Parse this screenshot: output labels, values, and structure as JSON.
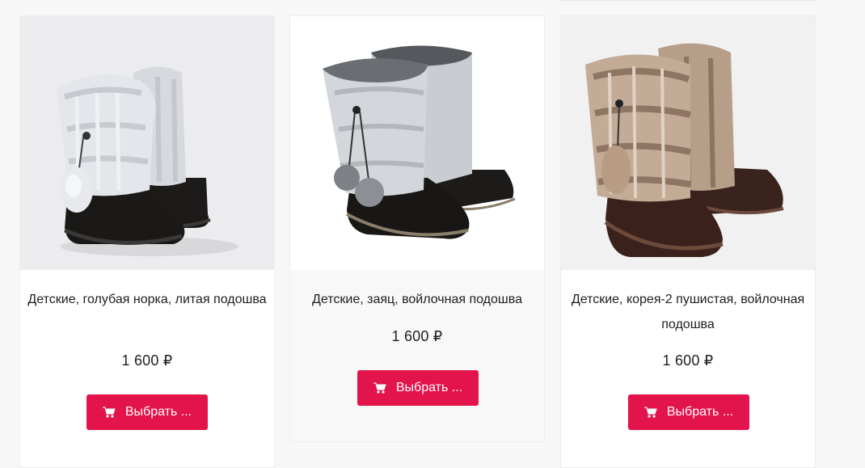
{
  "products": [
    {
      "title": "Детские, голубая норка, литая подошва",
      "price": "1 600 ₽",
      "button_label": "Выбрать ...",
      "icon": "cart-icon"
    },
    {
      "title": "Детские, заяц, войлочная подошва",
      "price": "1 600 ₽",
      "button_label": "Выбрать ...",
      "icon": "cart-icon"
    },
    {
      "title": "Детские, корея-2 пушистая, войлочная подошва",
      "price": "1 600 ₽",
      "button_label": "Выбрать ...",
      "icon": "cart-icon"
    }
  ],
  "colors": {
    "button": "#e3144c",
    "fur_light": "#dfe3e8",
    "fur_gray": "#b9bcc0",
    "fur_brown": "#b89c84",
    "boot_black": "#1d1b1a",
    "boot_brown": "#3d241f"
  }
}
